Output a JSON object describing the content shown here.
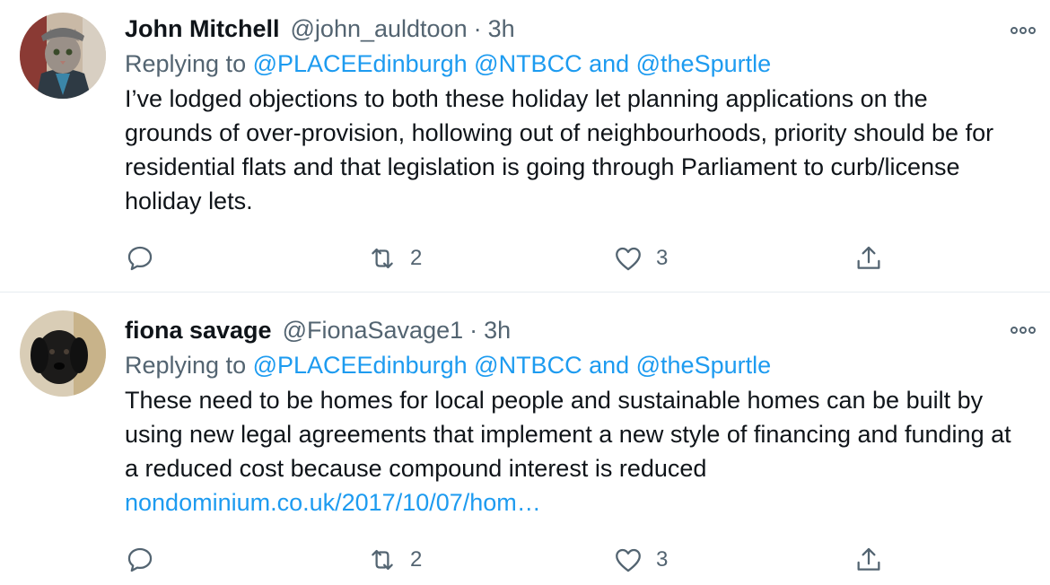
{
  "tweets": [
    {
      "name": "John Mitchell",
      "handle": "@john_auldtoon",
      "separator": "·",
      "time": "3h",
      "replying_prefix": "Replying to ",
      "mentions": [
        "@PLACEEdinburgh",
        "@NTBCC",
        "@theSpurtle"
      ],
      "and_word": " and ",
      "text": "I’ve lodged objections to both these holiday let planning applications on the grounds of over-provision, hollowing out of neighbourhoods, priority should be for residential flats and that legislation is going through Parliament to curb/license holiday lets.",
      "link": "",
      "reply_count": "",
      "retweet_count": "2",
      "like_count": "3",
      "avatar_icon": "cat-in-flat-cap-avatar"
    },
    {
      "name": "fiona savage",
      "handle": "@FionaSavage1",
      "separator": "·",
      "time": "3h",
      "replying_prefix": "Replying to ",
      "mentions": [
        "@PLACEEdinburgh",
        "@NTBCC",
        "@theSpurtle"
      ],
      "and_word": " and ",
      "text": "These need to be homes for local people and sustainable homes can be built by using new legal agreements that implement a new style of financing and funding at a reduced cost because compound interest is reduced ",
      "link": "nondominium.co.uk/2017/10/07/hom…",
      "reply_count": "",
      "retweet_count": "2",
      "like_count": "3",
      "avatar_icon": "black-puppy-avatar"
    }
  ],
  "icons": {
    "reply": "reply-icon",
    "retweet": "retweet-icon",
    "like": "heart-icon",
    "share": "share-icon",
    "more": "more-options-icon"
  },
  "colors": {
    "text": "#0f1419",
    "secondary": "#536471",
    "accent": "#1d9bf0",
    "divider": "#e6ecf0"
  }
}
